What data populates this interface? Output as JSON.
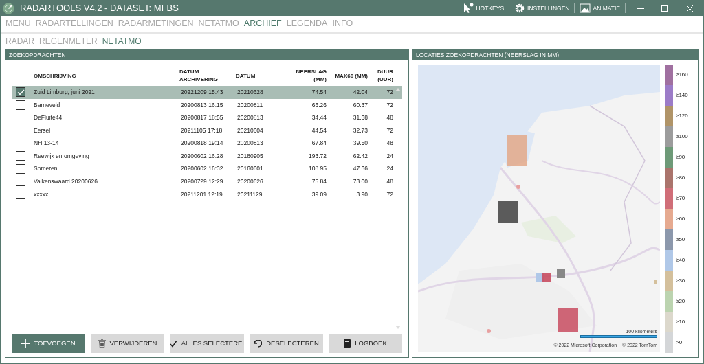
{
  "window": {
    "title": "RADARTOOLS V4.2 - DATASET: MFBS",
    "actions": [
      {
        "kind": "hotkeys",
        "label": "HOTKEYS"
      },
      {
        "kind": "settings",
        "label": "INSTELLINGEN"
      },
      {
        "kind": "animation",
        "label": "ANIMATIE"
      }
    ]
  },
  "menu": [
    {
      "label": "MENU",
      "selected": false
    },
    {
      "label": "RADARTELLINGEN",
      "selected": false
    },
    {
      "label": "RADARMETINGEN",
      "selected": false
    },
    {
      "label": "NETATMO",
      "selected": false
    },
    {
      "label": "ARCHIEF",
      "selected": true
    },
    {
      "label": "LEGENDA",
      "selected": false
    },
    {
      "label": "INFO",
      "selected": false
    }
  ],
  "subtabs": [
    {
      "label": "RADAR",
      "selected": false
    },
    {
      "label": "REGENMETER",
      "selected": false
    },
    {
      "label": "NETATMO",
      "selected": true
    }
  ],
  "searches": {
    "title": "ZOEKOPDRACHTEN",
    "columns": [
      "OMSCHRIJVING",
      "DATUM ARCHIVERING",
      "DATUM",
      "NEERSLAG (MM)",
      "MAX60 (MM)",
      "DUUR (UUR)"
    ],
    "rows": [
      {
        "checked": true,
        "selected": true,
        "cells": [
          "Zuid Limburg, juni 2021",
          "20221209 15:43",
          "20210628",
          "74.54",
          "42.04",
          "72"
        ]
      },
      {
        "checked": false,
        "selected": false,
        "cells": [
          "Barneveld",
          "20200813 16:15",
          "20200811",
          "66.26",
          "60.37",
          "72"
        ]
      },
      {
        "checked": false,
        "selected": false,
        "cells": [
          "DeFluite44",
          "20200817 18:55",
          "20200813",
          "34.44",
          "31.68",
          "48"
        ]
      },
      {
        "checked": false,
        "selected": false,
        "cells": [
          "Eersel",
          "20211105 17:18",
          "20210604",
          "44.54",
          "32.73",
          "72"
        ]
      },
      {
        "checked": false,
        "selected": false,
        "cells": [
          "NH 13-14",
          "20200818 19:14",
          "20200813",
          "67.84",
          "39.50",
          "48"
        ]
      },
      {
        "checked": false,
        "selected": false,
        "cells": [
          "Reewijk en omgeving",
          "20200602 16:28",
          "20180905",
          "193.72",
          "62.42",
          "24"
        ]
      },
      {
        "checked": false,
        "selected": false,
        "cells": [
          "Someren",
          "20200602 16:32",
          "20160601",
          "108.95",
          "47.66",
          "24"
        ]
      },
      {
        "checked": false,
        "selected": false,
        "cells": [
          "Valkenswaard 20200626",
          "20200729 12:29",
          "20200626",
          "75.84",
          "73.00",
          "48"
        ]
      },
      {
        "checked": false,
        "selected": false,
        "cells": [
          "xxxxx",
          "20211201 12:19",
          "20211129",
          "39.09",
          "3.90",
          "72"
        ]
      }
    ],
    "buttons": [
      {
        "kind": "add",
        "label": "TOEVOEGEN"
      },
      {
        "kind": "delete",
        "label": "VERWIJDEREN"
      },
      {
        "kind": "selectall",
        "label": "ALLES SELECTEREI"
      },
      {
        "kind": "deselect",
        "label": "DESELECTEREN"
      },
      {
        "kind": "log",
        "label": "LOGBOEK"
      }
    ]
  },
  "map": {
    "title": "LOCATIES ZOEKOPDRACHTEN (NEERSLAG IN MM)",
    "scale": "100 kilometers",
    "copyright": [
      "© 2022 Microsoft Corporation",
      "© 2022 TomTom"
    ],
    "legend": [
      {
        "label": "≥160",
        "color": "#a070a0"
      },
      {
        "label": "≥140",
        "color": "#9c7cc8"
      },
      {
        "label": "≥120",
        "color": "#b09468"
      },
      {
        "label": "≥100",
        "color": "#9c9c9c"
      },
      {
        "label": "≥90",
        "color": "#6e9a78"
      },
      {
        "label": "≥80",
        "color": "#aa746c"
      },
      {
        "label": "≥70",
        "color": "#d06e78"
      },
      {
        "label": "≥60",
        "color": "#e6aa90"
      },
      {
        "label": "≥50",
        "color": "#8c98ac"
      },
      {
        "label": "≥40",
        "color": "#b0c8e8"
      },
      {
        "label": "≥30",
        "color": "#d4c09c"
      },
      {
        "label": "≥20",
        "color": "#bcd4b0"
      },
      {
        "label": "≥10",
        "color": "#dcd8cc"
      },
      {
        "label": ">0",
        "color": "#d4d6d8"
      }
    ]
  }
}
